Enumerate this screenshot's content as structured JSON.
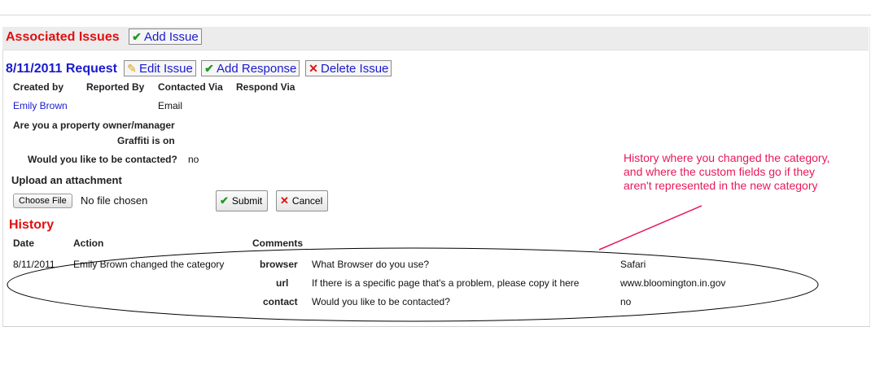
{
  "associated": {
    "title": "Associated Issues",
    "add_issue_label": "Add Issue"
  },
  "request": {
    "title": "8/11/2011 Request",
    "edit_label": "Edit Issue",
    "add_response_label": "Add Response",
    "delete_label": "Delete Issue",
    "columns": [
      "Created by",
      "Reported By",
      "Contacted Via",
      "Respond Via"
    ],
    "created_by": "Emily Brown",
    "contacted_via": "Email",
    "q_owner": "Are you a property owner/manager",
    "q_graffiti": "Graffiti is on",
    "q_contact": "Would you like to be contacted?",
    "a_contact": "no"
  },
  "upload": {
    "label": "Upload an attachment",
    "choose_label": "Choose File",
    "no_file": "No file chosen",
    "submit_label": "Submit",
    "cancel_label": "Cancel"
  },
  "history": {
    "title": "History",
    "columns": [
      "Date",
      "Action",
      "Comments"
    ],
    "date": "8/11/2011",
    "action": "Emily Brown changed the category",
    "rows": [
      {
        "field": "browser",
        "question": "What Browser do you use?",
        "answer": "Safari"
      },
      {
        "field": "url",
        "question": "If there is a specific page that's a problem, please copy it here",
        "answer": "www.bloomington.in.gov"
      },
      {
        "field": "contact",
        "question": "Would you like to be contacted?",
        "answer": "no"
      }
    ]
  },
  "annotation": {
    "lines": [
      "History where you changed the category,",
      "and where the custom fields go if they",
      "aren't represented in the new category"
    ],
    "color": "#e8185a"
  },
  "colors": {
    "heading_red": "#e01010",
    "heading_blue": "#1a1acf",
    "check_green": "#1f9a1f"
  },
  "icons": {
    "check": "check-icon",
    "pencil": "pencil-icon",
    "cross": "x-icon"
  }
}
